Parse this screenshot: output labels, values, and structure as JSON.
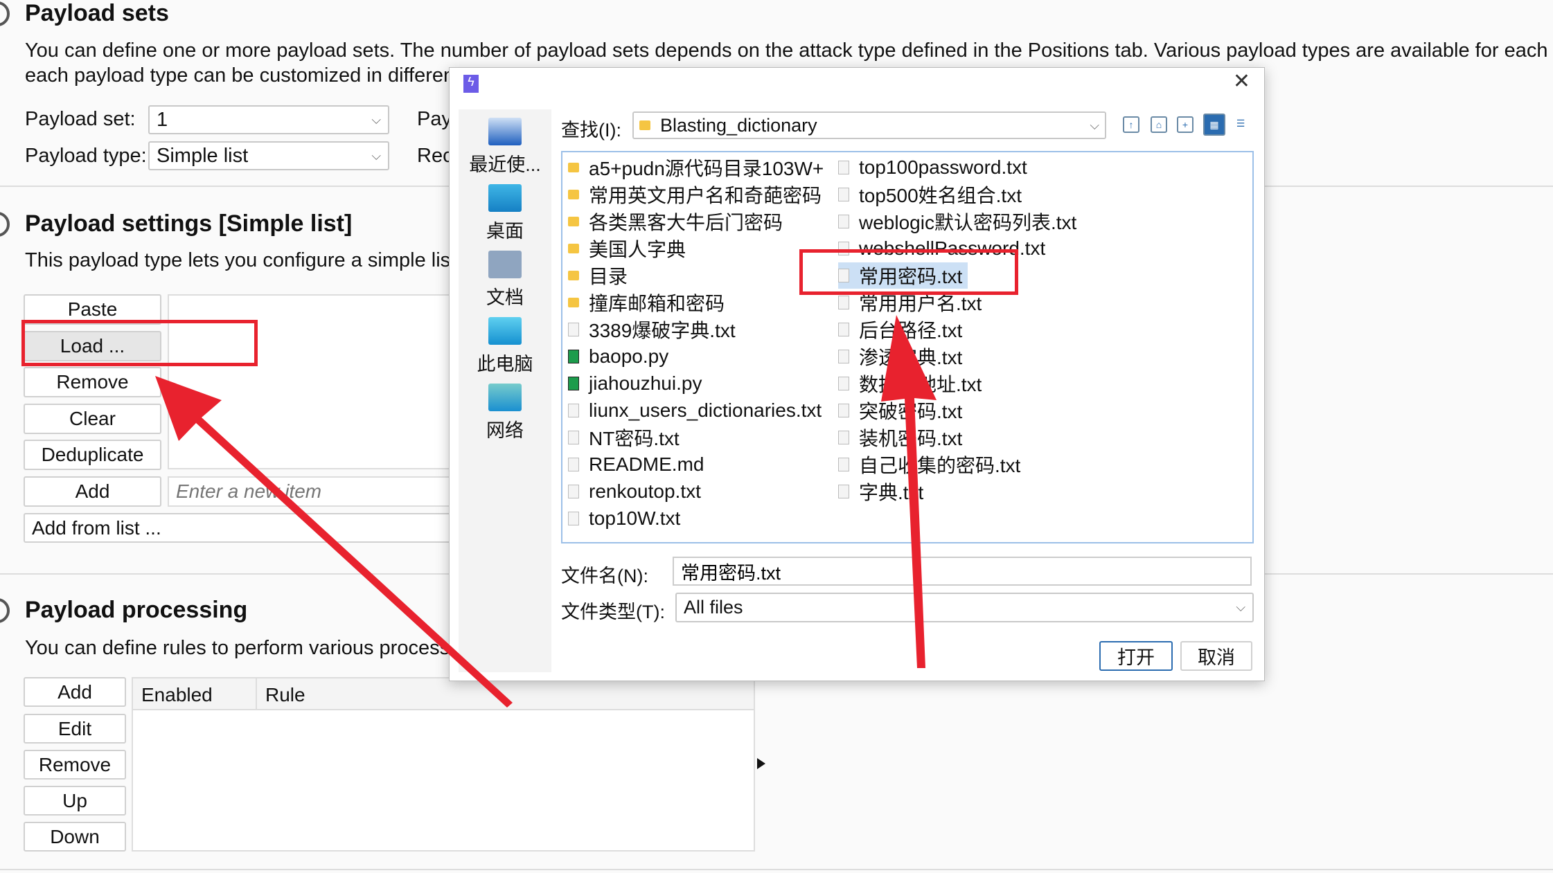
{
  "payload_sets": {
    "title": "Payload sets",
    "desc_line1": "You can define one or more payload sets. The number of payload sets depends on the attack type defined in the Positions tab. Various payload types are available for each",
    "desc_line2": "each payload type can be customized in differen",
    "set_label": "Payload set:",
    "set_value": "1",
    "type_label": "Payload type:",
    "type_value": "Simple list",
    "count_label_partial": "Pay",
    "request_label_partial": "Rec"
  },
  "payload_settings": {
    "title": "Payload settings [Simple list]",
    "desc": "This payload type lets you configure a simple lis",
    "buttons": [
      "Paste",
      "Load ...",
      "Remove",
      "Clear",
      "Deduplicate",
      "Add"
    ],
    "add_from_list": "Add from list ...",
    "new_item_placeholder": "Enter a new item"
  },
  "payload_processing": {
    "title": "Payload processing",
    "desc": "You can define rules to perform various process",
    "buttons": [
      "Add",
      "Edit",
      "Remove",
      "Up",
      "Down"
    ],
    "columns": [
      "Enabled",
      "Rule"
    ]
  },
  "dialog": {
    "close": "✕",
    "places": [
      "最近使...",
      "桌面",
      "文档",
      "此电脑",
      "网络"
    ],
    "look_in_label": "查找(I):",
    "look_in_value": "Blasting_dictionary",
    "files_col1": [
      {
        "name": "a5+pudn源代码目录103W+",
        "type": "folder"
      },
      {
        "name": "常用英文用户名和奇葩密码",
        "type": "folder"
      },
      {
        "name": "各类黑客大牛后门密码",
        "type": "folder"
      },
      {
        "name": "美国人字典",
        "type": "folder"
      },
      {
        "name": "目录",
        "type": "folder"
      },
      {
        "name": "撞库邮箱和密码",
        "type": "folder"
      },
      {
        "name": "3389爆破字典.txt",
        "type": "doc"
      },
      {
        "name": "baopo.py",
        "type": "py"
      },
      {
        "name": "jiahouzhui.py",
        "type": "py"
      },
      {
        "name": "liunx_users_dictionaries.txt",
        "type": "doc"
      },
      {
        "name": "NT密码.txt",
        "type": "doc"
      },
      {
        "name": "README.md",
        "type": "doc"
      },
      {
        "name": "renkoutop.txt",
        "type": "doc"
      },
      {
        "name": "top10W.txt",
        "type": "doc"
      }
    ],
    "files_col2": [
      {
        "name": "top100password.txt",
        "type": "doc"
      },
      {
        "name": "top500姓名组合.txt",
        "type": "doc"
      },
      {
        "name": "weblogic默认密码列表.txt",
        "type": "doc"
      },
      {
        "name": "webshellPassword.txt",
        "type": "doc"
      },
      {
        "name": "常用密码.txt",
        "type": "doc",
        "selected": true
      },
      {
        "name": "常用用户名.txt",
        "type": "doc"
      },
      {
        "name": "后台路径.txt",
        "type": "doc"
      },
      {
        "name": "渗透字典.txt",
        "type": "doc"
      },
      {
        "name": "数据库地址.txt",
        "type": "doc"
      },
      {
        "name": "突破密码.txt",
        "type": "doc"
      },
      {
        "name": "装机密码.txt",
        "type": "doc"
      },
      {
        "name": "自己收集的密码.txt",
        "type": "doc"
      },
      {
        "name": "字典.txt",
        "type": "doc"
      }
    ],
    "filename_label": "文件名(N):",
    "filename_value": "常用密码.txt",
    "filetype_label": "文件类型(T):",
    "filetype_value": "All files",
    "open": "打开",
    "cancel": "取消"
  },
  "colors": {
    "annotation": "#e8222e",
    "selection": "#cce0f5",
    "accent": "#2b6cb0"
  }
}
